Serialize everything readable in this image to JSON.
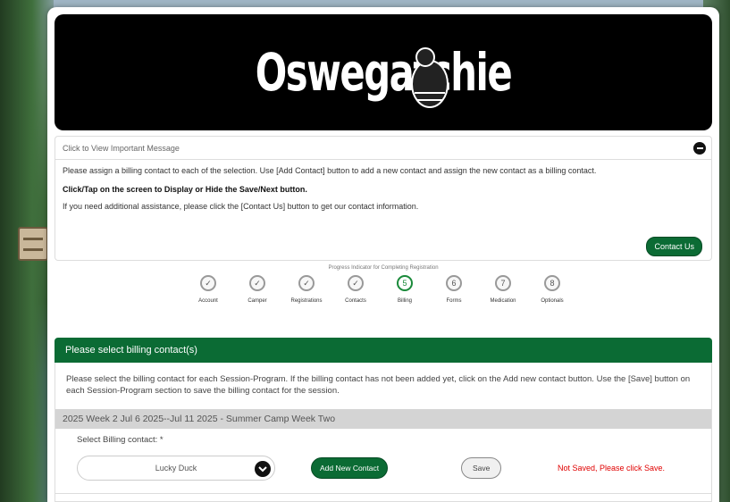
{
  "banner": {
    "logo_text": "Oswegatchie"
  },
  "message": {
    "header": "Click to View Important Message",
    "paragraph1": "Please assign a billing contact to each of the selection. Use [Add Contact] button to add a new contact and assign the new contact as a billing contact.",
    "bold_line": "Click/Tap on the screen to Display or Hide the Save/Next button.",
    "paragraph2": "If you need additional assistance, please click the [Contact Us] button to get our contact information.",
    "contact_button": "Contact Us"
  },
  "progress": {
    "title": "Progress Indicator for Completing Registration",
    "steps": [
      {
        "symbol": "✓",
        "label": "Account"
      },
      {
        "symbol": "✓",
        "label": "Camper"
      },
      {
        "symbol": "✓",
        "label": "Registrations"
      },
      {
        "symbol": "✓",
        "label": "Contacts"
      },
      {
        "symbol": "5",
        "label": "Billing"
      },
      {
        "symbol": "6",
        "label": "Forms"
      },
      {
        "symbol": "7",
        "label": "Medication"
      },
      {
        "symbol": "8",
        "label": "Optionals"
      }
    ],
    "current_step": 5
  },
  "billing": {
    "section_title": "Please select billing contact(s)",
    "description": "Please select the billing contact for each Session-Program. If the billing contact has not been added yet, click on the Add new contact button. Use the [Save] button on each Session-Program section to save the billing contact for the session.",
    "session_title": "2025 Week 2 Jul 6 2025--Jul 11 2025 - Summer Camp Week Two",
    "select_label": "Select Billing contact: *",
    "selected_contact": "Lucky Duck",
    "add_button": "Add New Contact",
    "save_button": "Save",
    "status_text": "Not Saved, Please click Save."
  },
  "colors": {
    "brand_green": "#0b6b34",
    "error_red": "#e00000"
  }
}
